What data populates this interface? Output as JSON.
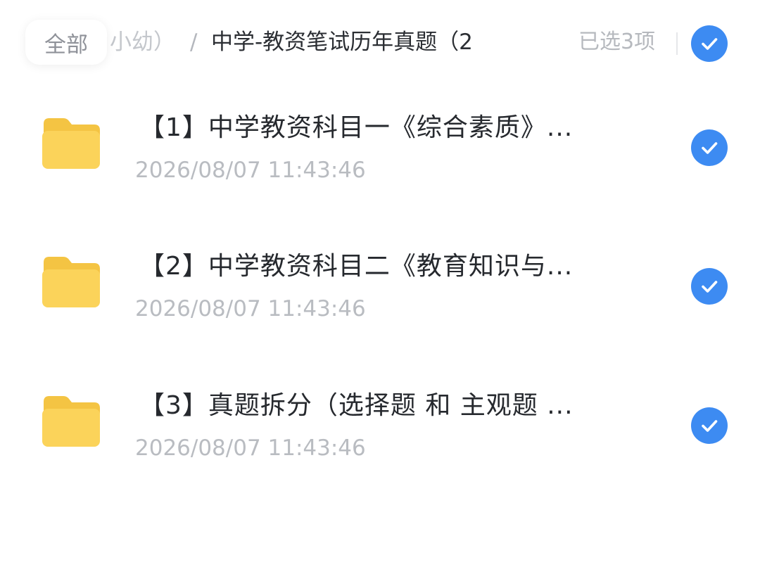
{
  "breadcrumb": {
    "all_label": "全部",
    "previous_label": "小幼）",
    "separator": "/",
    "current_label": "中学-教资笔试历年真题（2"
  },
  "selection": {
    "count_label": "已选3项",
    "select_all_checked": true
  },
  "files": [
    {
      "icon": "folder-icon",
      "title": "【1】中学教资科目一《综合素质》...",
      "date": "2026/08/07 11:43:46",
      "checked": true
    },
    {
      "icon": "folder-icon",
      "title": "【2】中学教资科目二《教育知识与...",
      "date": "2026/08/07 11:43:46",
      "checked": true
    },
    {
      "icon": "folder-icon",
      "title": "【3】真题拆分（选择题 和 主观题 ...",
      "date": "2026/08/07 11:43:46",
      "checked": true
    }
  ],
  "colors": {
    "accent": "#3d8bf2",
    "folder": "#fbd35a",
    "date_text": "#b9bcc1"
  }
}
